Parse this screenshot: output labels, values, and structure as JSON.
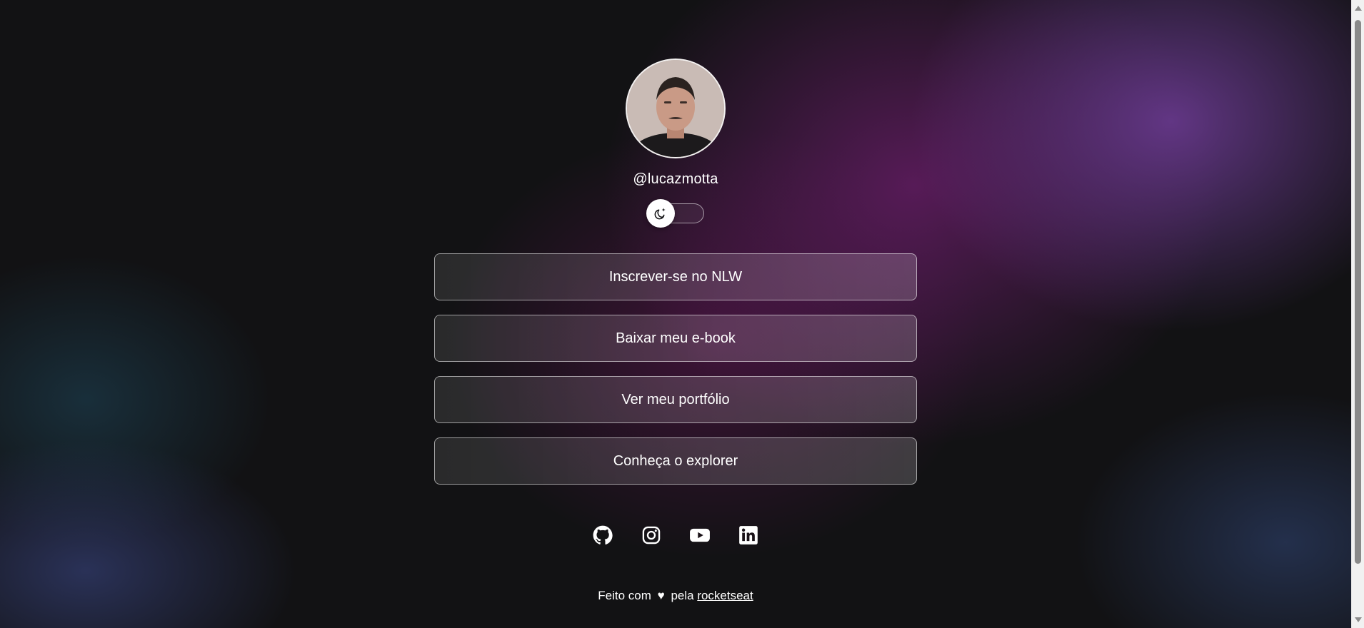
{
  "profile": {
    "handle": "@lucazmotta"
  },
  "theme_switch": {
    "state": "dark",
    "icon": "moon-stars-icon"
  },
  "links": [
    {
      "label": "Inscrever-se no NLW"
    },
    {
      "label": "Baixar meu e-book"
    },
    {
      "label": "Ver meu portfólio"
    },
    {
      "label": "Conheça o explorer"
    }
  ],
  "socials": [
    {
      "icon": "github-icon"
    },
    {
      "icon": "instagram-icon"
    },
    {
      "icon": "youtube-icon"
    },
    {
      "icon": "linkedin-icon"
    }
  ],
  "footer": {
    "text_before": "Feito com",
    "heart": "♥",
    "text_middle": "pela",
    "link_label": "rocketseat"
  },
  "colors": {
    "background": "#121214",
    "accent_purple": "#6e3c96",
    "accent_magenta": "#6e1e6e"
  }
}
